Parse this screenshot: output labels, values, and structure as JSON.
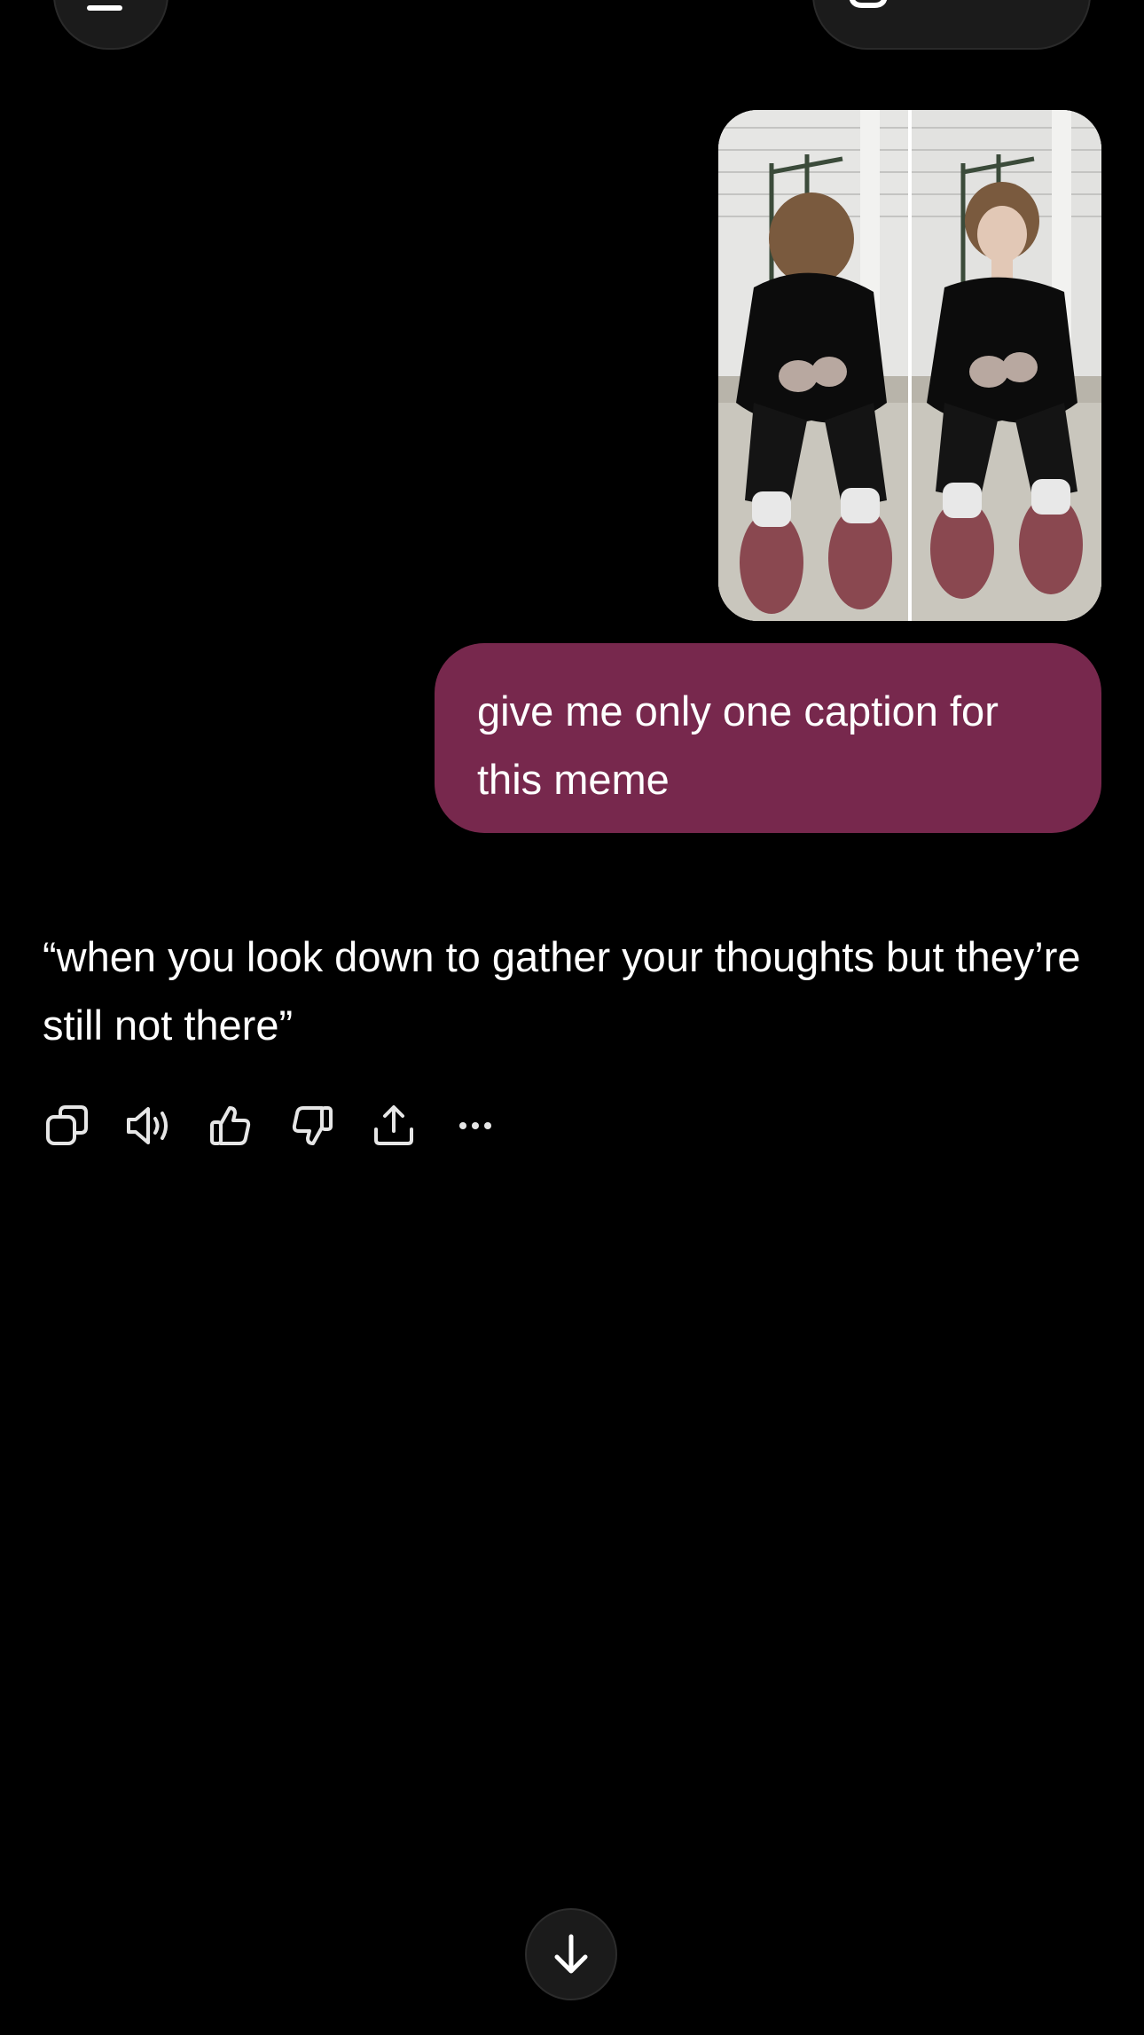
{
  "header": {
    "menu_icon": "menu-icon",
    "new_chat_icon": "new-chat-icon"
  },
  "conversation": {
    "user_attachment": {
      "icon": "photo-attachment"
    },
    "user_message": "give me only one caption for this meme",
    "assistant_message": "“when you look down to gather your thoughts but they’re still not there”"
  },
  "message_actions": [
    {
      "icon": "copy-icon"
    },
    {
      "icon": "read-aloud-icon"
    },
    {
      "icon": "thumbs-up-icon"
    },
    {
      "icon": "thumbs-down-icon"
    },
    {
      "icon": "share-icon"
    },
    {
      "icon": "more-icon"
    }
  ],
  "scroll": {
    "icon": "arrow-down-icon"
  },
  "colors": {
    "background": "#000000",
    "user_bubble": "#77284d",
    "text": "#ffffff",
    "button_bg": "#1b1b1b"
  }
}
